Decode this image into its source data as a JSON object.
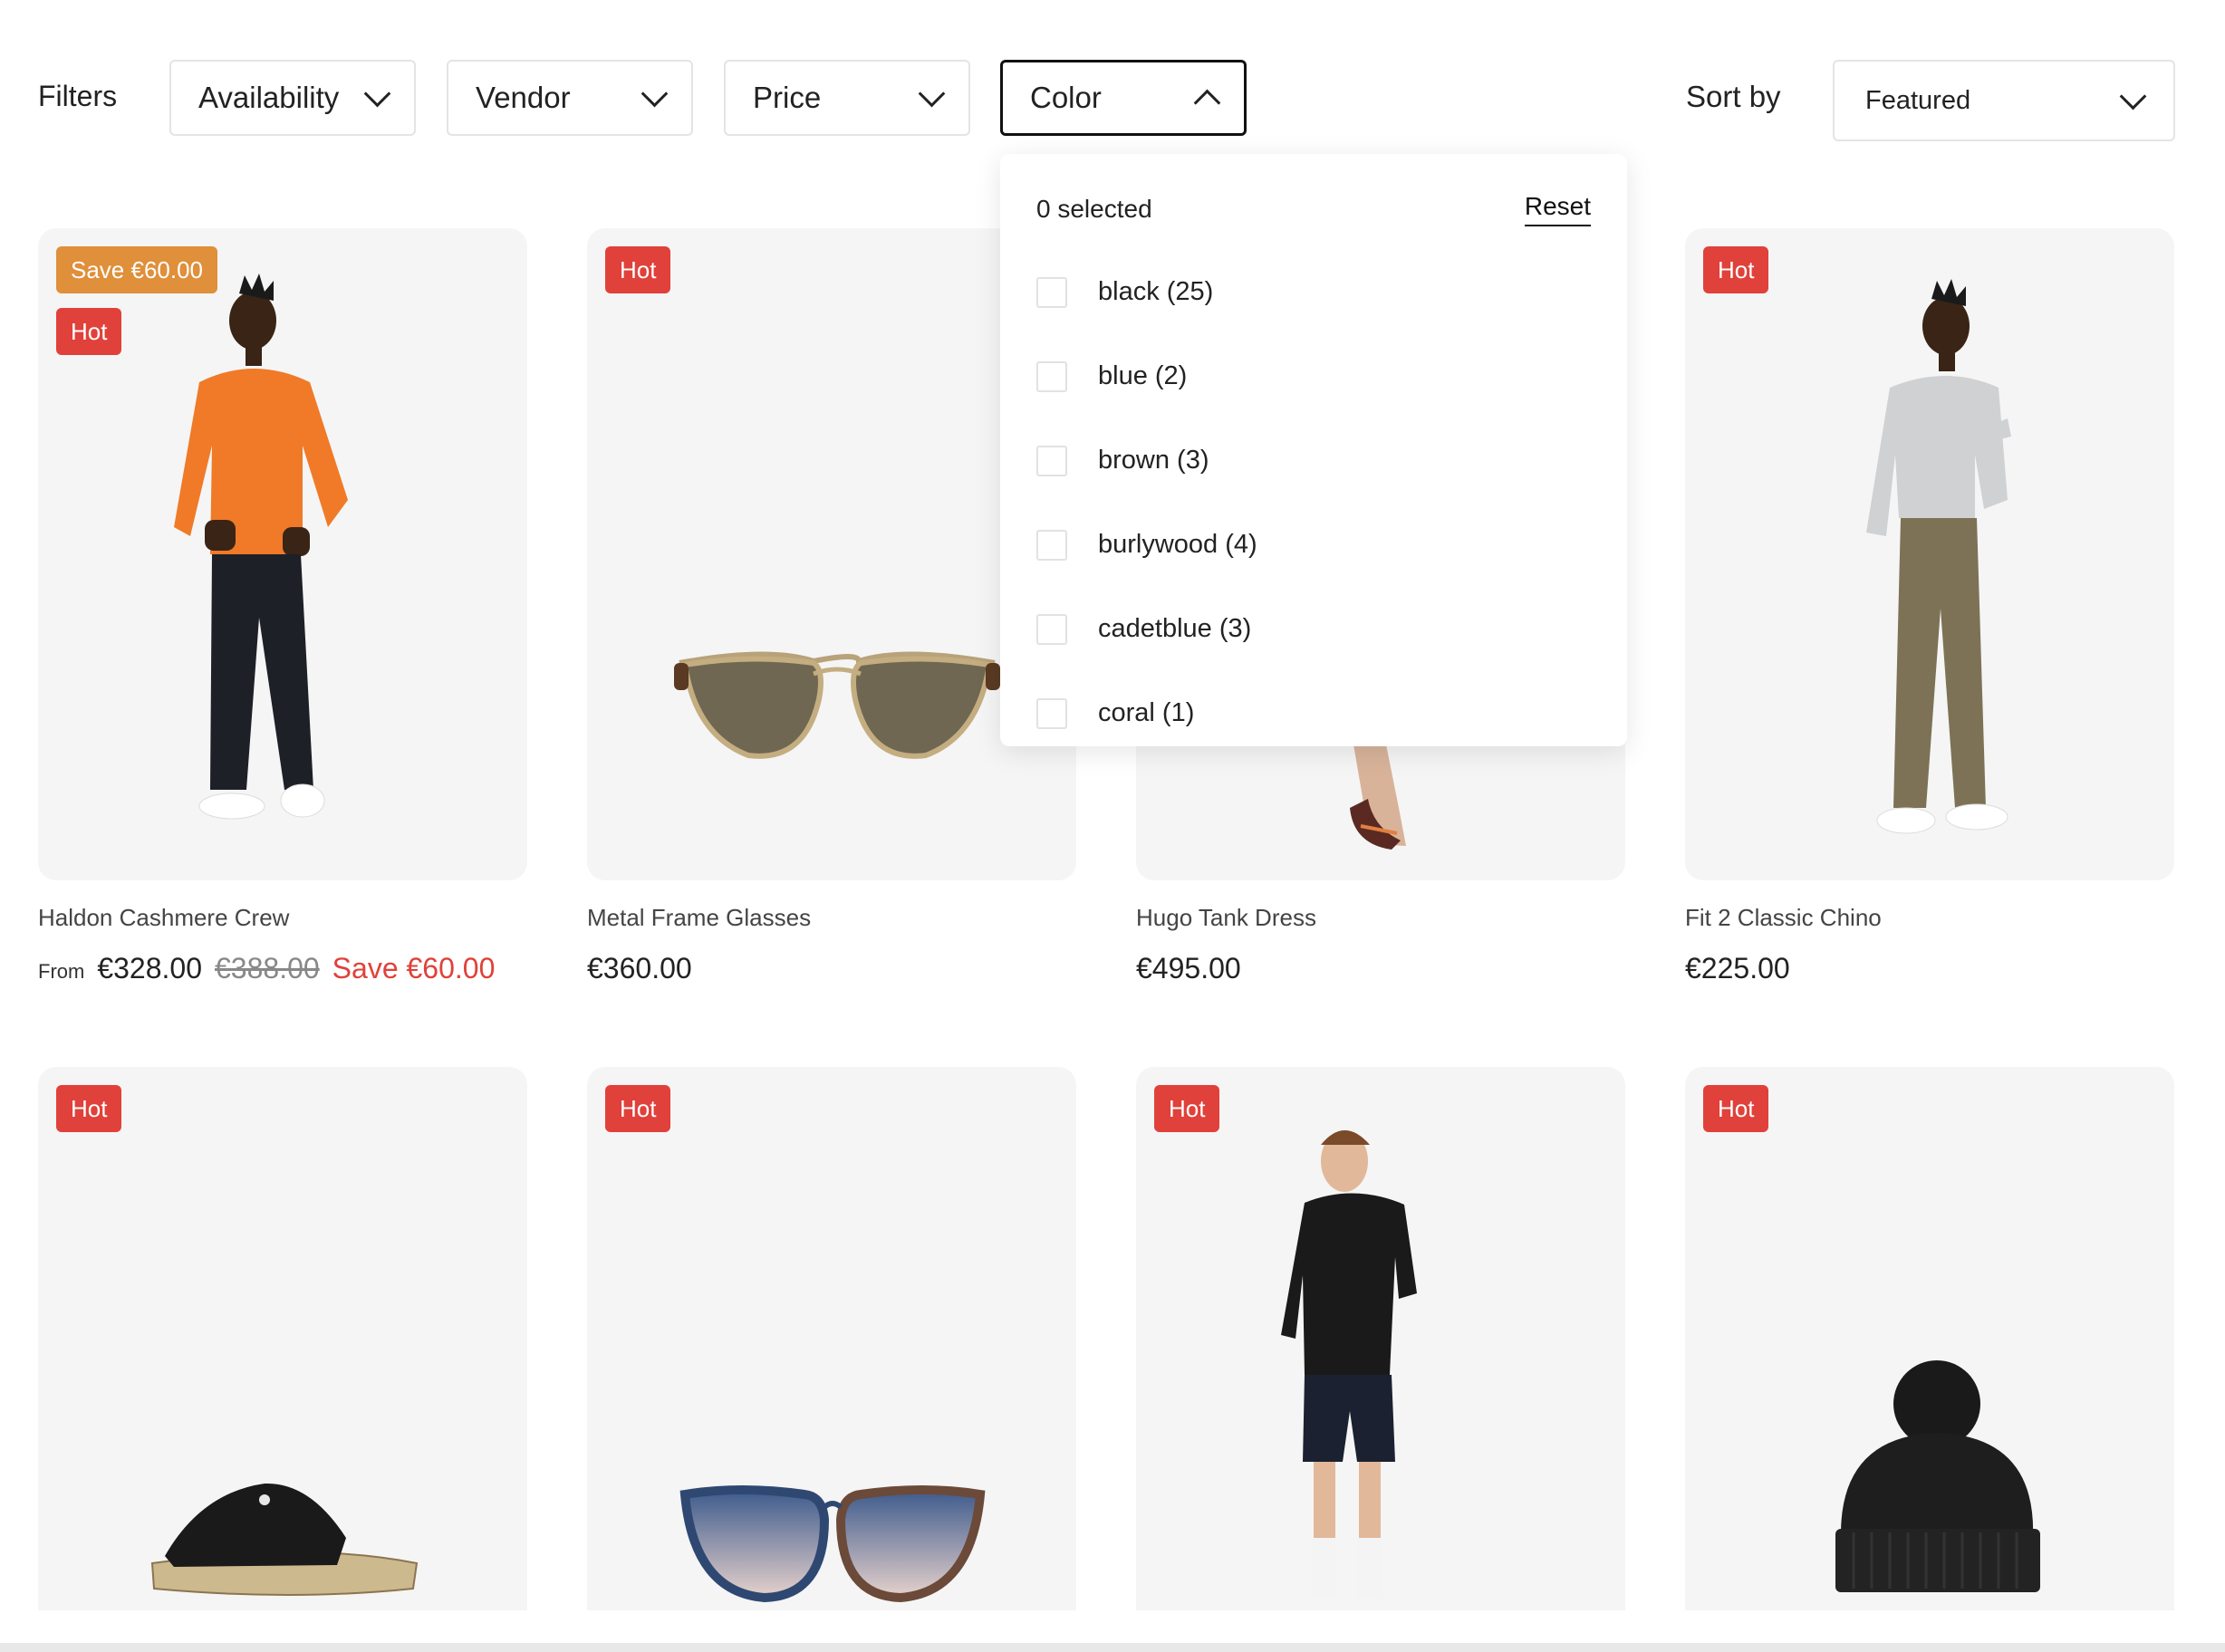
{
  "filters": {
    "label": "Filters",
    "availability": "Availability",
    "vendor": "Vendor",
    "price": "Price",
    "color": "Color"
  },
  "sort": {
    "label": "Sort by",
    "value": "Featured"
  },
  "color_panel": {
    "selected": "0 selected",
    "reset": "Reset",
    "options": [
      "black (25)",
      "blue (2)",
      "brown (3)",
      "burlywood (4)",
      "cadetblue (3)",
      "coral (1)"
    ]
  },
  "products": [
    {
      "badges": [
        "Save €60.00",
        "Hot"
      ],
      "title": "Haldon Cashmere Crew",
      "from": "From",
      "price": "€328.00",
      "old_price": "€388.00",
      "save": "Save €60.00"
    },
    {
      "badges": [
        "Hot"
      ],
      "title": "Metal Frame Glasses",
      "price": "€360.00"
    },
    {
      "badges": [],
      "title": "Hugo Tank Dress",
      "price": "€495.00"
    },
    {
      "badges": [
        "Hot"
      ],
      "title": "Fit 2 Classic Chino",
      "price": "€225.00"
    },
    {
      "badges": [
        "Hot"
      ]
    },
    {
      "badges": [
        "Hot"
      ]
    },
    {
      "badges": [
        "Hot"
      ]
    },
    {
      "badges": [
        "Hot"
      ]
    }
  ],
  "colors": {
    "hot": "#e0413a",
    "save_badge": "#e08f3a",
    "card_bg": "#f5f5f5"
  }
}
